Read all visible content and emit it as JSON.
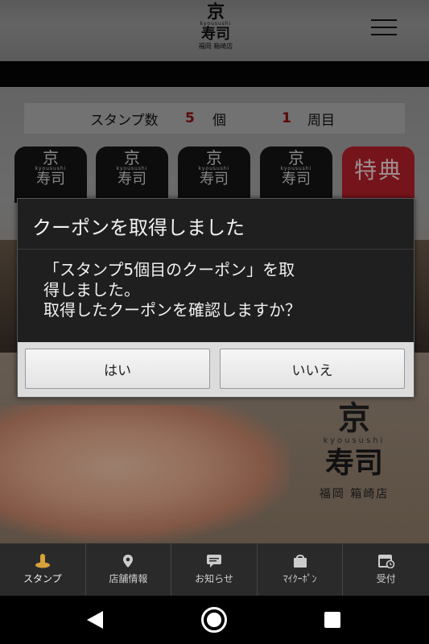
{
  "header": {
    "logo": {
      "top": "京",
      "romaji": "kyousushi",
      "main": "寿司",
      "store": "福岡 箱崎店"
    }
  },
  "stamp_count": {
    "label": "スタンプ数",
    "count": "5",
    "unit": "個",
    "lap": "1",
    "lap_label": "周目"
  },
  "stamps": [
    {
      "top": "京",
      "romaji": "kyousushi",
      "main": "寿司"
    },
    {
      "top": "京",
      "romaji": "kyousushi",
      "main": "寿司"
    },
    {
      "top": "京",
      "romaji": "kyousushi",
      "main": "寿司"
    },
    {
      "top": "京",
      "romaji": "kyousushi",
      "main": "寿司"
    }
  ],
  "special_stamp": {
    "label": "特典"
  },
  "brand": {
    "top": "京",
    "romaji": "kyousushi",
    "main": "寿司",
    "store": "福岡 箱崎店"
  },
  "dialog": {
    "title": "クーポンを取得しました",
    "message": "「スタンプ5個目のクーポン」を取\n得しました。\n取得したクーポンを確認しますか？",
    "yes_label": "はい",
    "no_label": "いいえ"
  },
  "tabbar": {
    "items": [
      {
        "label": "スタンプ",
        "icon": "stamp-icon"
      },
      {
        "label": "店舗情報",
        "icon": "map-pin-icon"
      },
      {
        "label": "お知らせ",
        "icon": "chat-bubble-icon"
      },
      {
        "label": "ﾏｲｸｰﾎﾟﾝ",
        "icon": "bag-icon"
      },
      {
        "label": "受付",
        "icon": "calendar-clock-icon"
      }
    ]
  },
  "colors": {
    "accent_red": "#8b0d0d",
    "special_red": "#b61f2a",
    "tabbar": "#2a2a2a"
  }
}
